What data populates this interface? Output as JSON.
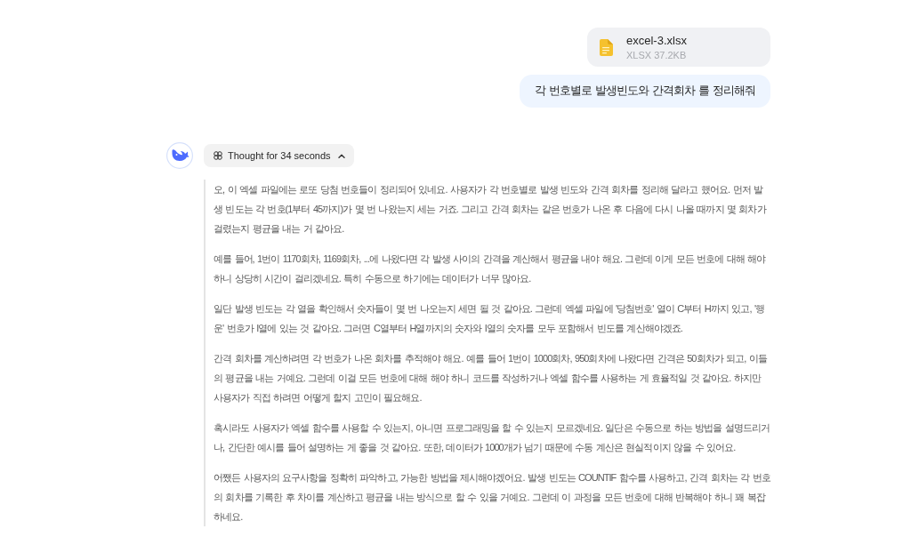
{
  "attachment": {
    "file_name": "excel-3.xlsx",
    "file_info": "XLSX 37.2KB"
  },
  "user_message": "각 번호별로 발생빈도와 간격회차 를 정리해줘",
  "assistant": {
    "thought_toggle": {
      "label": "Thought for 34 seconds",
      "expanded": true
    },
    "thinking_paragraphs": [
      "오, 이 엑셀 파일에는 로또 당첨 번호들이 정리되어 있네요. 사용자가 각 번호별로 발생 빈도와 간격 회차를 정리해 달라고 했어요. 먼저 발생 빈도는 각 번호(1부터 45까지)가 몇 번 나왔는지 세는 거죠. 그리고 간격 회차는 같은 번호가 나온 후 다음에 다시 나올 때까지 몇 회차가 걸렸는지 평균을 내는 거 같아요.",
      "예를 들어, 1번이 1170회차, 1169회차, ...에 나왔다면 각 발생 사이의 간격을 계산해서 평균을 내야 해요. 그런데 이게 모든 번호에 대해 해야 하니 상당히 시간이 걸리겠네요. 특히 수동으로 하기에는 데이터가 너무 많아요.",
      "일단 발생 빈도는 각 열을 확인해서 숫자들이 몇 번 나오는지 세면 될 것 같아요. 그런데 엑셀 파일에 '당첨번호' 열이 C부터 H까지 있고, '행운' 번호가 I열에 있는 것 같아요. 그러면 C열부터 H열까지의 숫자와 I열의 숫자를 모두 포함해서 빈도를 계산해야겠죠.",
      "간격 회차를 계산하려면 각 번호가 나온 회차를 추적해야 해요. 예를 들어 1번이 1000회차, 950회차에 나왔다면 간격은 50회차가 되고, 이들의 평균을 내는 거예요. 그런데 이걸 모든 번호에 대해 해야 하니 코드를 작성하거나 엑셀 함수를 사용하는 게 효율적일 것 같아요. 하지만 사용자가 직접 하려면 어떻게 할지 고민이 필요해요.",
      "혹시라도 사용자가 엑셀 함수를 사용할 수 있는지, 아니면 프로그래밍을 할 수 있는지 모르겠네요. 일단은 수동으로 하는 방법을 설명드리거나, 간단한 예시를 들어 설명하는 게 좋을 것 같아요. 또한, 데이터가 1000개가 넘기 때문에 수동 계산은 현실적이지 않을 수 있어요.",
      "어쨌든 사용자의 요구사항을 정확히 파악하고, 가능한 방법을 제시해야겠어요. 발생 빈도는 COUNTIF 함수를 사용하고, 간격 회차는 각 번호의 회차를 기록한 후 차이를 계산하고 평균을 내는 방식으로 할 수 있을 거예요. 그런데 이 과정을 모든 번호에 대해 반복해야 하니 꽤 복잡하네요."
    ]
  }
}
